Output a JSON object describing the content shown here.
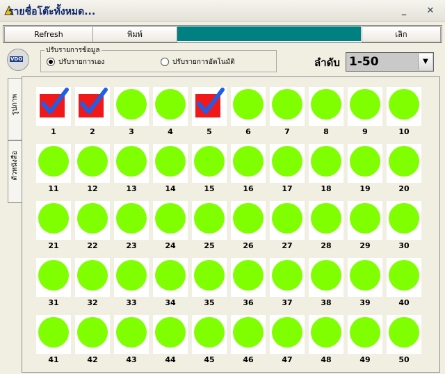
{
  "window": {
    "title": "รายชื่อโต๊ะทั้งหมด..."
  },
  "toolbar": {
    "refresh_label": "Refresh",
    "print_label": "พิมพ์",
    "cancel_label": "เลิก"
  },
  "logo": {
    "text": "VDO"
  },
  "mode_group": {
    "title": "ปรับรายการข้อมูล",
    "options": [
      {
        "label": "ปรับรายการเอง",
        "selected": true
      },
      {
        "label": "ปรับรายการอัตโนมัติ",
        "selected": false
      }
    ]
  },
  "order": {
    "label": "ลำดับ",
    "value": "1-50"
  },
  "tabs": [
    {
      "label": "รูปภาพ"
    },
    {
      "label": "ตัวหนังสือ"
    }
  ],
  "tables": [
    {
      "number": "1",
      "checked": true
    },
    {
      "number": "2",
      "checked": true
    },
    {
      "number": "3",
      "checked": false
    },
    {
      "number": "4",
      "checked": false
    },
    {
      "number": "5",
      "checked": true
    },
    {
      "number": "6",
      "checked": false
    },
    {
      "number": "7",
      "checked": false
    },
    {
      "number": "8",
      "checked": false
    },
    {
      "number": "9",
      "checked": false
    },
    {
      "number": "10",
      "checked": false
    },
    {
      "number": "11",
      "checked": false
    },
    {
      "number": "12",
      "checked": false
    },
    {
      "number": "13",
      "checked": false
    },
    {
      "number": "14",
      "checked": false
    },
    {
      "number": "15",
      "checked": false
    },
    {
      "number": "16",
      "checked": false
    },
    {
      "number": "17",
      "checked": false
    },
    {
      "number": "18",
      "checked": false
    },
    {
      "number": "19",
      "checked": false
    },
    {
      "number": "20",
      "checked": false
    },
    {
      "number": "21",
      "checked": false
    },
    {
      "number": "22",
      "checked": false
    },
    {
      "number": "23",
      "checked": false
    },
    {
      "number": "24",
      "checked": false
    },
    {
      "number": "25",
      "checked": false
    },
    {
      "number": "26",
      "checked": false
    },
    {
      "number": "27",
      "checked": false
    },
    {
      "number": "28",
      "checked": false
    },
    {
      "number": "29",
      "checked": false
    },
    {
      "number": "30",
      "checked": false
    },
    {
      "number": "31",
      "checked": false
    },
    {
      "number": "32",
      "checked": false
    },
    {
      "number": "33",
      "checked": false
    },
    {
      "number": "34",
      "checked": false
    },
    {
      "number": "35",
      "checked": false
    },
    {
      "number": "36",
      "checked": false
    },
    {
      "number": "37",
      "checked": false
    },
    {
      "number": "38",
      "checked": false
    },
    {
      "number": "39",
      "checked": false
    },
    {
      "number": "40",
      "checked": false
    },
    {
      "number": "41",
      "checked": false
    },
    {
      "number": "42",
      "checked": false
    },
    {
      "number": "43",
      "checked": false
    },
    {
      "number": "44",
      "checked": false
    },
    {
      "number": "45",
      "checked": false
    },
    {
      "number": "46",
      "checked": false
    },
    {
      "number": "47",
      "checked": false
    },
    {
      "number": "48",
      "checked": false
    },
    {
      "number": "49",
      "checked": false
    },
    {
      "number": "50",
      "checked": false
    }
  ],
  "colors": {
    "available": "#80FF00",
    "checked_bg": "#F01818",
    "check_mark": "#1E5EE8",
    "toolbar_fill": "#008080"
  }
}
